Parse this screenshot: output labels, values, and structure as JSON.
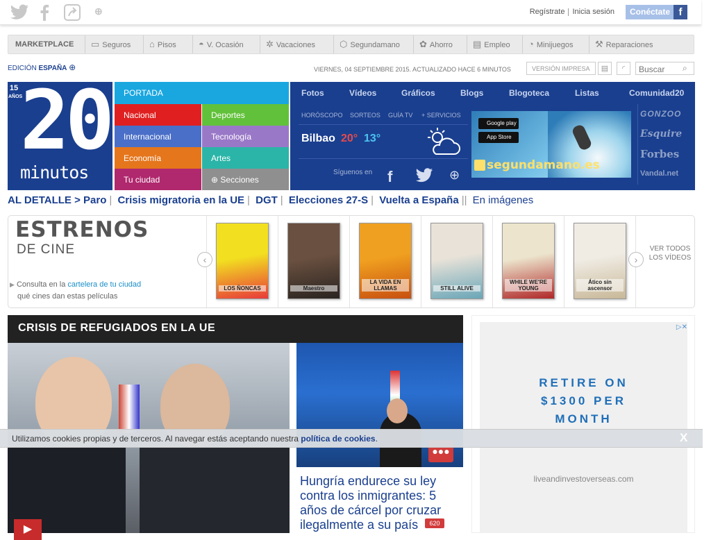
{
  "header": {
    "login": {
      "register": "Regístrate",
      "sign_in": "Inicia sesión"
    },
    "connect": "Conéctate"
  },
  "marketplace": {
    "title": "MARKETPLACE",
    "items": [
      "Seguros",
      "Pisos",
      "V. Ocasión",
      "Vacaciones",
      "Segundamano",
      "Ahorro",
      "Empleo",
      "Minijuegos",
      "Reparaciones"
    ]
  },
  "edition": {
    "prefix": "EDICIÓN",
    "region": "ESPAÑA"
  },
  "date_text": "VIERNES, 04 SEPTIEMBRE 2015. ACTUALIZADO HACE 6 MINUTOS",
  "print_label": "VERSIÓN IMPRESA",
  "search": {
    "placeholder": "Buscar"
  },
  "logo": {
    "number": "20",
    "word": "minutos",
    "anniv_num": "15",
    "anniv_word": "AÑOS"
  },
  "sections": {
    "portada": "PORTADA",
    "left": [
      "Nacional",
      "Internacional",
      "Economía",
      "Tu ciudad"
    ],
    "right": [
      "Deportes",
      "Tecnología",
      "Artes",
      "Secciones"
    ],
    "colors": {
      "portada": "#1aa7e0",
      "nacional": "#e02020",
      "internacional": "#4a6fc8",
      "economia": "#e5761c",
      "tuciudad": "#b0286e",
      "deportes": "#62c13a",
      "tecnologia": "#9a78c8",
      "artes": "#2bb5a8",
      "secciones": "#8f8f8f"
    }
  },
  "bluenav": {
    "top": [
      "Fotos",
      "Vídeos",
      "Gráficos",
      "Blogs",
      "Blogoteca",
      "Listas",
      "Comunidad20"
    ],
    "small": [
      "HORÓSCOPO",
      "SORTEOS",
      "GUÍA TV",
      "+ SERVICIOS"
    ],
    "weather": {
      "city": "Bilbao",
      "high": "20°",
      "low": "13°"
    },
    "follow": "Síguenos en",
    "brands": [
      "GONZOO",
      "Esquire",
      "Forbes",
      "Vandal.net"
    ]
  },
  "ad_banner": {
    "store1": "Google play",
    "store2": "App Store",
    "brand": "segundamano.es"
  },
  "topics": [
    "AL DETALLE > Paro",
    "Crisis migratoria en la UE",
    "DGT",
    "Elecciones 27-S",
    "Vuelta a España",
    "En imágenes"
  ],
  "cinema": {
    "title1": "ESTRENOS",
    "title2": "DE CINE",
    "note_prefix": "Consulta en la",
    "note_link": "cartelera de tu ciudad",
    "note_suffix": "qué cines dan estas películas",
    "see_all": "VER TODOS LOS VÍDEOS",
    "posters": [
      {
        "title": "LOS ÑONCAS",
        "colors": [
          "#f2e020",
          "#e83a3a"
        ]
      },
      {
        "title": "Maestro",
        "colors": [
          "#6a5040",
          "#2a2420"
        ]
      },
      {
        "title": "LA VIDA EN LLAMAS",
        "colors": [
          "#f0a020",
          "#c85010"
        ]
      },
      {
        "title": "STILL ALIVE",
        "colors": [
          "#e8e2d8",
          "#6aa6b8"
        ]
      },
      {
        "title": "WHILE WE'RE YOUNG",
        "colors": [
          "#ece4cc",
          "#b02828"
        ]
      },
      {
        "title": "Ático sin ascensor",
        "colors": [
          "#f0ece4",
          "#c8b898"
        ]
      }
    ]
  },
  "crisis": {
    "heading": "CRISIS DE REFUGIADOS EN LA UE",
    "side_title": "Hungría endurece su ley contra los inmigrantes: 5 años de cárcel por cruzar ilegalmente a su país",
    "comments": "620"
  },
  "ad_right": {
    "text": "RETIRE ON $1300 PER MONTH",
    "url": "liveandinvestoverseas.com"
  },
  "cookie": {
    "text": "Utilizamos cookies propias y de terceros. Al navegar estás aceptando nuestra",
    "link": "política de cookies",
    "close": "X"
  }
}
